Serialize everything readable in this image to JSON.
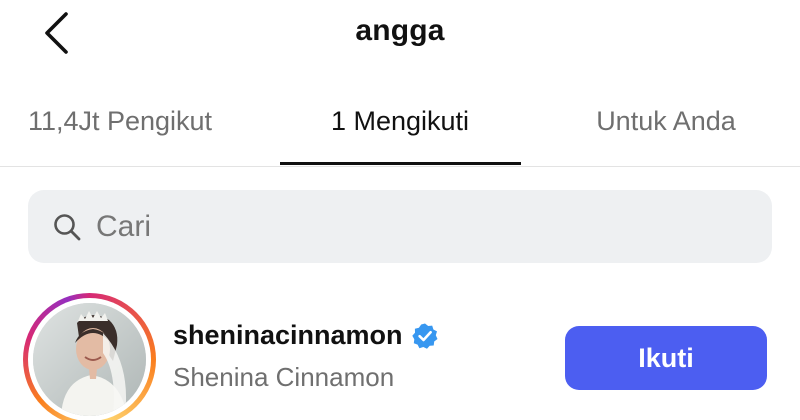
{
  "header": {
    "title": "angga",
    "back_icon": "chevron-left-icon"
  },
  "tabs": [
    {
      "label": "11,4Jt Pengikut",
      "active": false
    },
    {
      "label": "1 Mengikuti",
      "active": true
    },
    {
      "label": "Untuk Anda",
      "active": false
    }
  ],
  "search": {
    "placeholder": "Cari",
    "value": "",
    "icon": "search-icon"
  },
  "following": [
    {
      "username": "sheninacinnamon",
      "full_name": "Shenina Cinnamon",
      "verified": true,
      "follow_label": "Ikuti"
    }
  ],
  "colors": {
    "accent": "#4c5ef1",
    "verified": "#3797f0",
    "muted_text": "#6f6f6f",
    "search_bg": "#eef0f2"
  }
}
